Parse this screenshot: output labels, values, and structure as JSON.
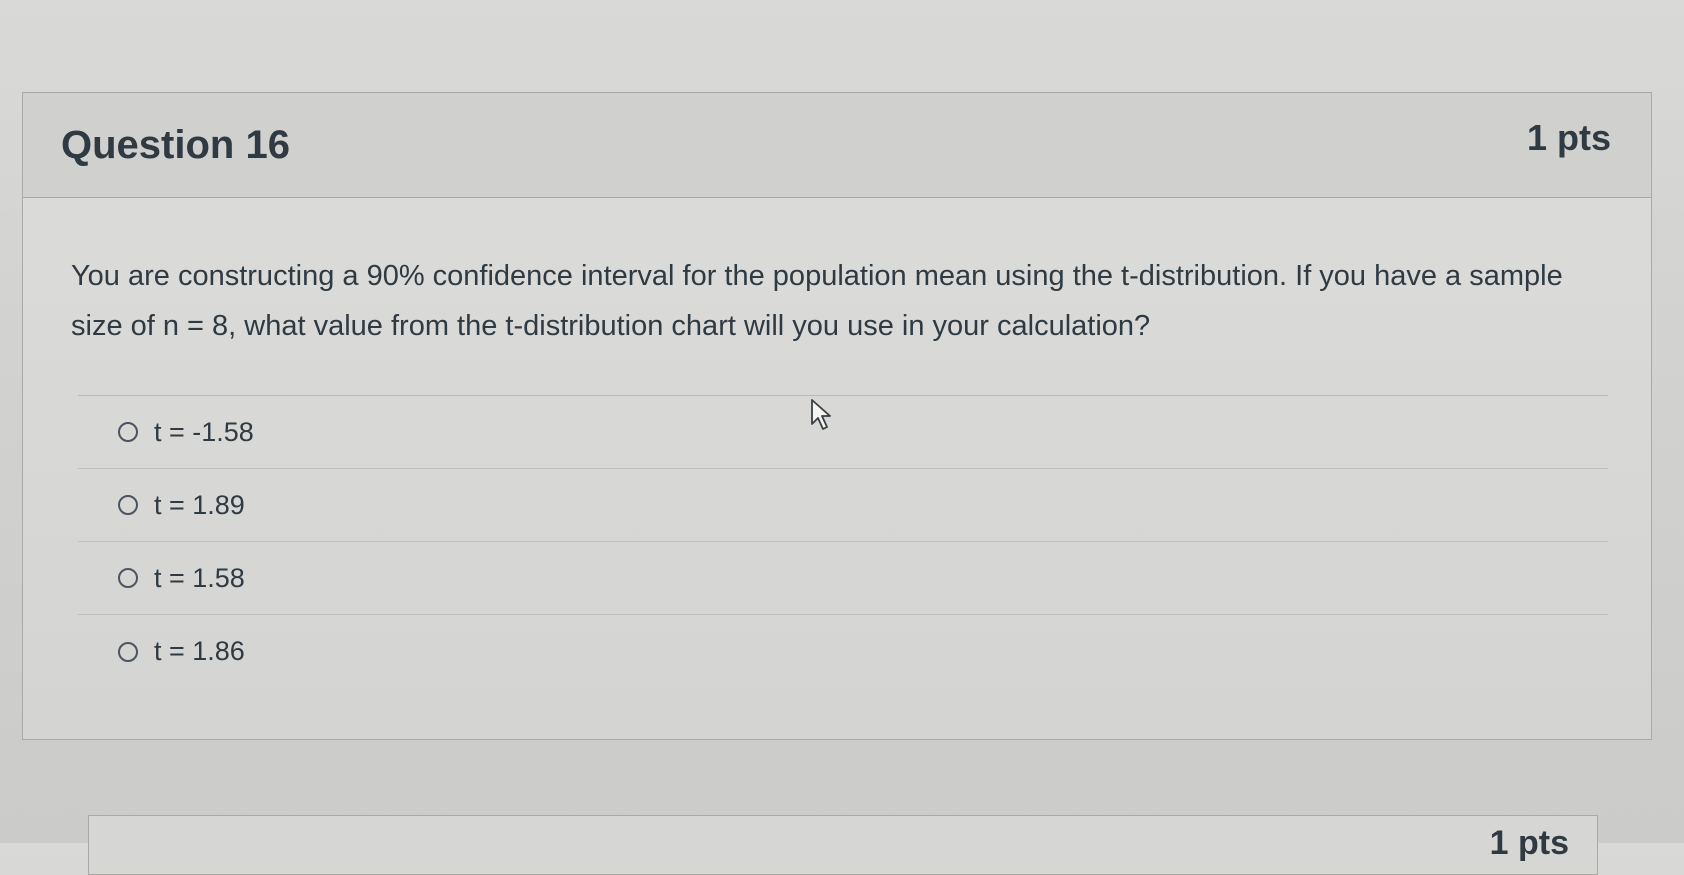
{
  "question": {
    "title": "Question 16",
    "points": "1 pts",
    "text": "You are constructing a 90% confidence interval for the population mean using the t-distribution. If you have a sample size of n = 8, what value from the t-distribution chart will you use in your calculation?",
    "answers": [
      {
        "label": "t = -1.58"
      },
      {
        "label": "t = 1.89"
      },
      {
        "label": "t = 1.58"
      },
      {
        "label": "t = 1.86"
      }
    ]
  },
  "next_question": {
    "points": "1 pts"
  },
  "icons": {
    "cursor": "mouse-pointer-icon",
    "radio": "radio-unselected-icon"
  }
}
